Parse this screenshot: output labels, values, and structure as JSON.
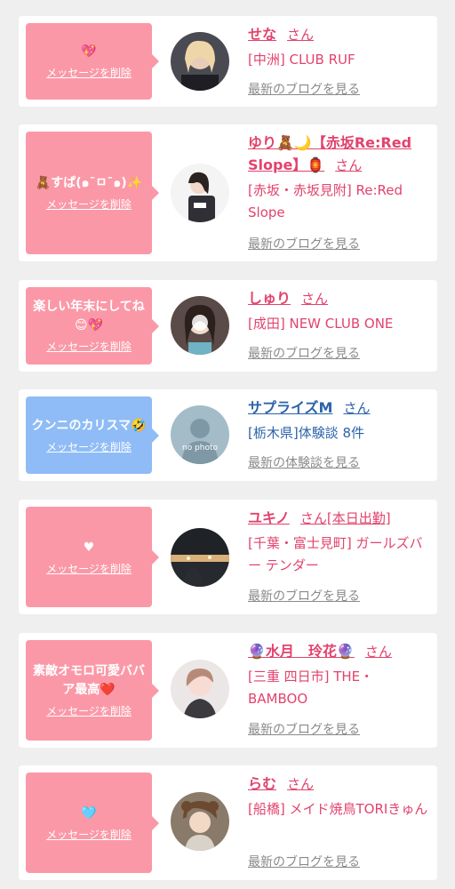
{
  "posts": [
    {
      "message": "💖",
      "delete_label": "メッセージを削除",
      "name": "せな",
      "honorific": "さん",
      "shop": "[中洲] CLUB RUF",
      "link": "最新のブログを見る"
    },
    {
      "message": "🧸すぱ(๑¯ㅁ¯๑)✨",
      "delete_label": "メッセージを削除",
      "name": "ゆり🧸🌙【赤坂Re:Red Slope】🏮",
      "honorific": "さん",
      "shop": "[赤坂・赤坂見附] Re:Red Slope",
      "link": "最新のブログを見る"
    },
    {
      "message": "楽しい年末にしてね😊💖",
      "delete_label": "メッセージを削除",
      "name": "しゅり",
      "honorific": "さん",
      "shop": "[成田] NEW CLUB ONE",
      "link": "最新のブログを見る"
    },
    {
      "message": "クンニのカリスマ🤣",
      "delete_label": "メッセージを削除",
      "name": "サプライズM",
      "honorific": "さん",
      "shop": "[栃木県]体験談 8件",
      "link": "最新の体験談を見る",
      "avatar_text": "no photo"
    },
    {
      "message": "♥",
      "delete_label": "メッセージを削除",
      "name": "ユキノ",
      "honorific": "さん[本日出勤]",
      "shop": "[千葉・富士見町] ガールズバー テンダー",
      "link": "最新のブログを見る"
    },
    {
      "message": "素敵オモロ可愛ババア最高❤️",
      "delete_label": "メッセージを削除",
      "name": "🔮水月　玲花🔮",
      "honorific": "さん",
      "shop": "[三重 四日市] THE・BAMBOO",
      "link": "最新のブログを見る"
    },
    {
      "message": "🩵",
      "delete_label": "メッセージを削除",
      "name": "らむ",
      "honorific": "さん",
      "shop": "[船橋] メイド焼鳥TORIきゅん",
      "link": "最新のブログを見る"
    }
  ],
  "colors": {
    "accent_pink": "#e2436d",
    "bubble_pink": "#fb98a7",
    "accent_blue": "#2c63a8",
    "bubble_blue": "#8fbcf6",
    "link_gray": "#8a8a8a"
  }
}
